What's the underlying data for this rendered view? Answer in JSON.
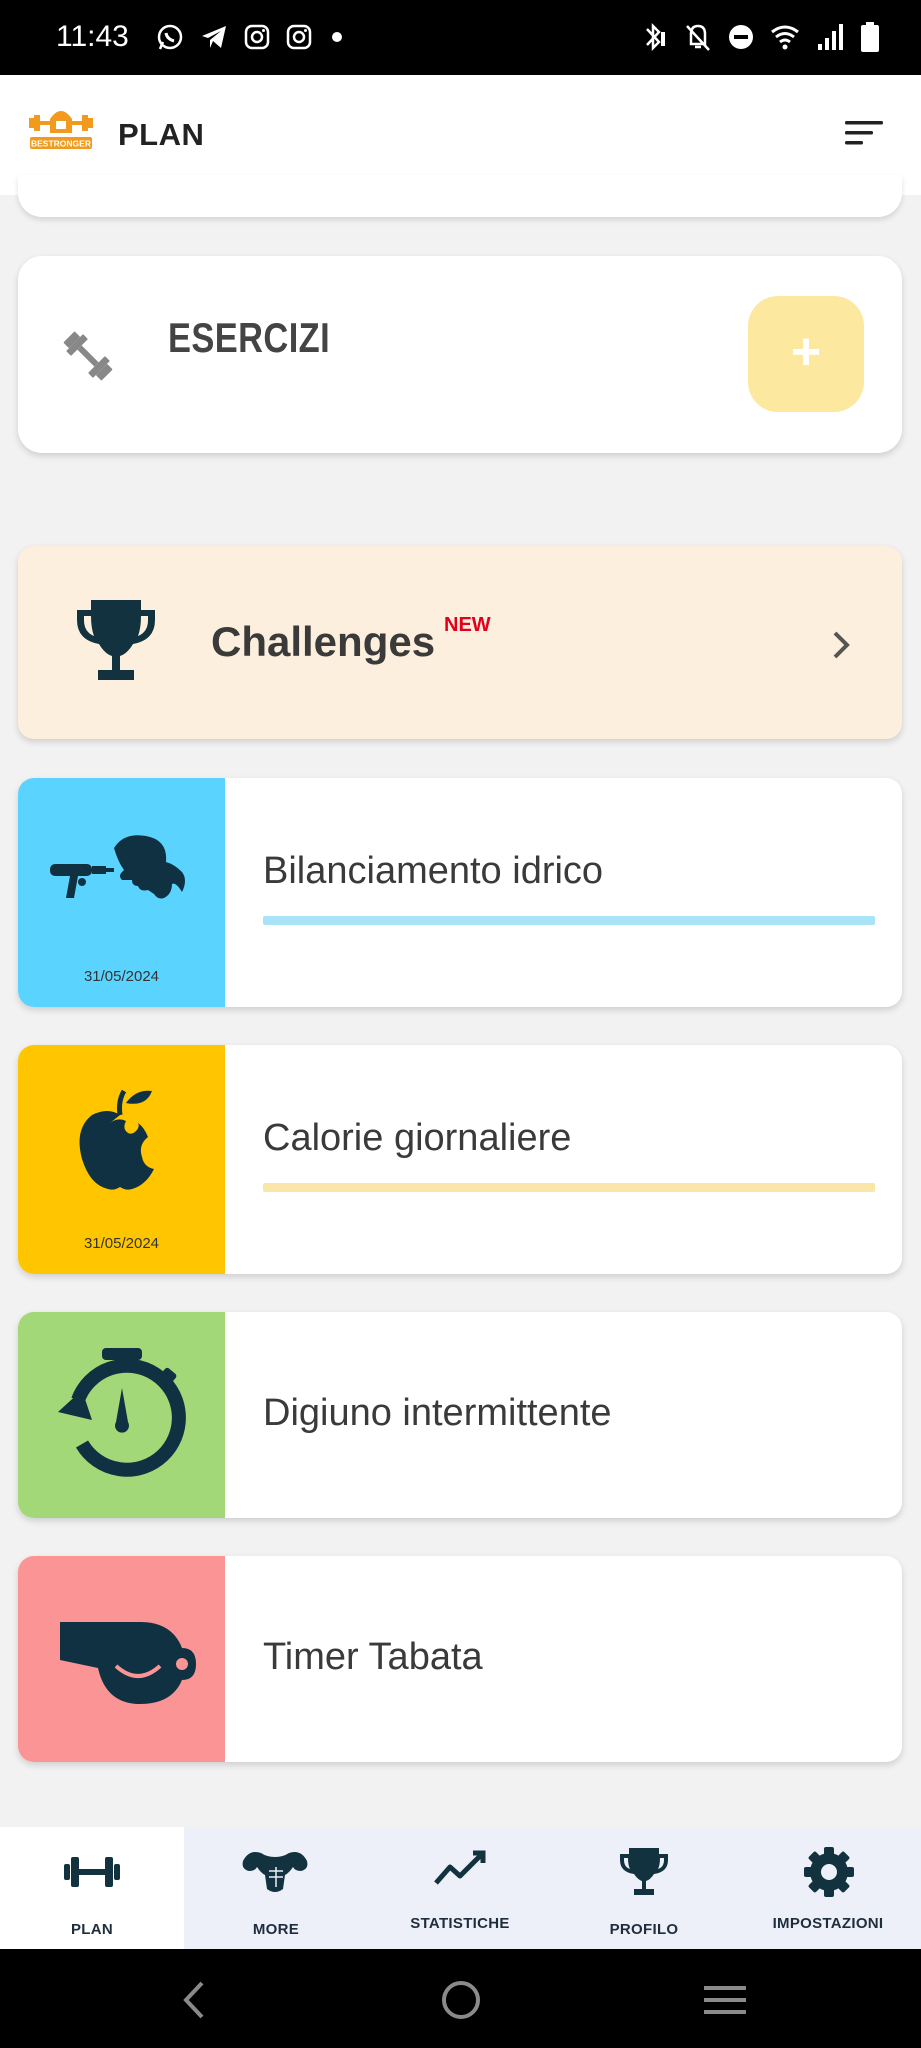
{
  "status_bar": {
    "time": "11:43",
    "left_icons": [
      "whatsapp-icon",
      "telegram-icon",
      "instagram-icon",
      "instagram-icon",
      "dot-icon"
    ],
    "right_icons": [
      "bluetooth-icon",
      "mute-icon",
      "dnd-icon",
      "wifi-icon",
      "signal-icon",
      "battery-icon"
    ]
  },
  "app_bar": {
    "title": "PLAN",
    "logo_text": "BESTRONGER"
  },
  "exercise_card": {
    "label": "ESERCIZI",
    "add_label": "+"
  },
  "challenges_card": {
    "label": "Challenges",
    "badge": "NEW"
  },
  "features": [
    {
      "label": "Bilanciamento idrico",
      "date": "31/05/2024",
      "tile_color": "#5bd3ff",
      "bar_color": "#a8e3f8"
    },
    {
      "label": "Calorie giornaliere",
      "date": "31/05/2024",
      "tile_color": "#ffc600",
      "bar_color": "#fbe6a9"
    },
    {
      "label": "Digiuno intermittente",
      "tile_color": "#a2d877"
    },
    {
      "label": "Timer Tabata",
      "tile_color": "#fb9494"
    }
  ],
  "bottom_nav": {
    "items": [
      {
        "label": "PLAN",
        "icon": "dumbbell-icon",
        "active": true
      },
      {
        "label": "MORE",
        "icon": "muscle-icon",
        "active": false
      },
      {
        "label": "STATISTICHE",
        "icon": "chart-line-icon",
        "active": false
      },
      {
        "label": "PROFILO",
        "icon": "trophy-icon",
        "active": false
      },
      {
        "label": "IMPOSTAZIONI",
        "icon": "gear-icon",
        "active": false
      }
    ]
  },
  "system_nav": [
    "back-icon",
    "home-icon",
    "recents-icon"
  ]
}
